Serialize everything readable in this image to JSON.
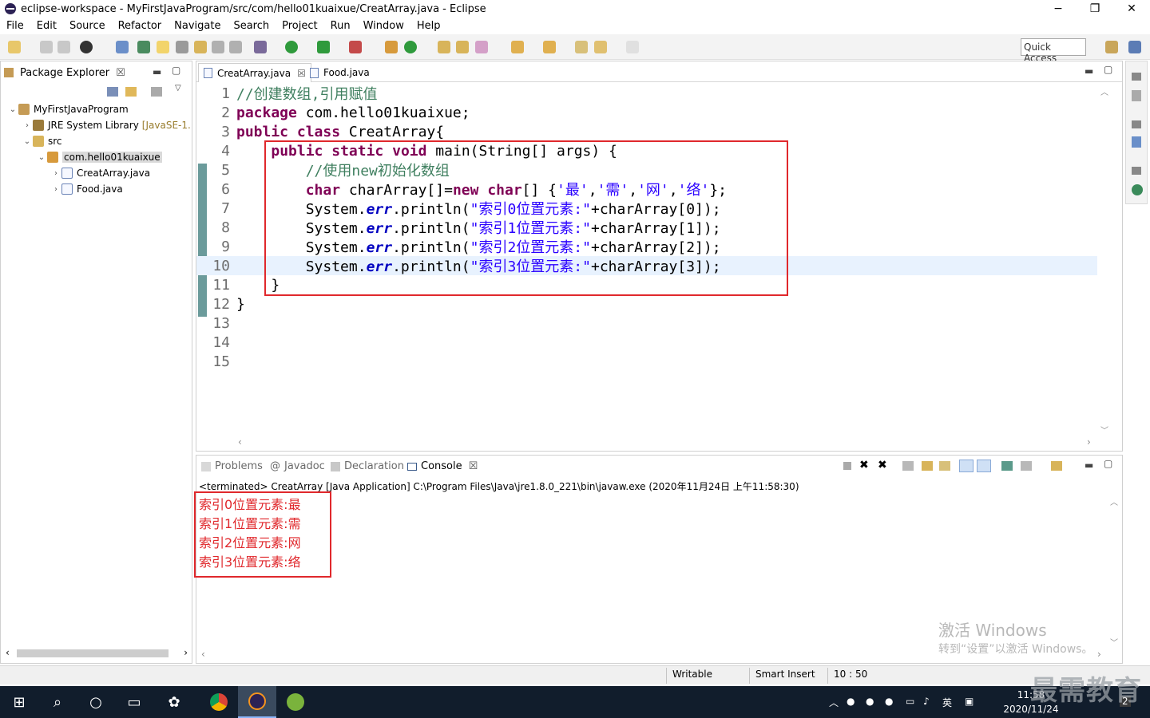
{
  "window": {
    "title": "eclipse-workspace - MyFirstJavaProgram/src/com/hello01kuaixue/CreatArray.java - Eclipse",
    "minimize": "−",
    "maximize": "❐",
    "close": "✕"
  },
  "menu": [
    "File",
    "Edit",
    "Source",
    "Refactor",
    "Navigate",
    "Search",
    "Project",
    "Run",
    "Window",
    "Help"
  ],
  "toolbar": {
    "quick_access": "Quick Access"
  },
  "package_explorer": {
    "tab_label": "Package Explorer",
    "tree": [
      {
        "label": "MyFirstJavaProgram",
        "decor": ""
      },
      {
        "label": "JRE System Library",
        "decor": "[JavaSE-1."
      },
      {
        "label": "src",
        "decor": ""
      },
      {
        "label": "com.hello01kuaixue",
        "decor": ""
      },
      {
        "label": "CreatArray.java",
        "decor": ""
      },
      {
        "label": "Food.java",
        "decor": ""
      }
    ]
  },
  "editor": {
    "tabs": [
      "CreatArray.java",
      "Food.java"
    ],
    "line_numbers": [
      "1",
      "2",
      "3",
      "4",
      "5",
      "6",
      "7",
      "8",
      "9",
      "10",
      "11",
      "12",
      "13",
      "14",
      "15"
    ],
    "lines": [
      [
        {
          "t": "//创建数组,引用赋值",
          "c": "cm"
        }
      ],
      [
        {
          "t": "package",
          "c": "kw"
        },
        {
          "t": " com.hello01kuaixue;",
          "c": ""
        }
      ],
      [
        {
          "t": "public",
          "c": "kw"
        },
        {
          "t": " ",
          "c": ""
        },
        {
          "t": "class",
          "c": "kw"
        },
        {
          "t": " CreatArray{",
          "c": ""
        }
      ],
      [
        {
          "t": "    ",
          "c": ""
        },
        {
          "t": "public",
          "c": "kw"
        },
        {
          "t": " ",
          "c": ""
        },
        {
          "t": "static",
          "c": "kw"
        },
        {
          "t": " ",
          "c": ""
        },
        {
          "t": "void",
          "c": "kw"
        },
        {
          "t": " main(String[] args) {",
          "c": ""
        }
      ],
      [
        {
          "t": "        //使用new初始化数组",
          "c": "cm"
        }
      ],
      [
        {
          "t": "        ",
          "c": ""
        },
        {
          "t": "char",
          "c": "kw"
        },
        {
          "t": " charArray[]=",
          "c": ""
        },
        {
          "t": "new",
          "c": "kw"
        },
        {
          "t": " ",
          "c": ""
        },
        {
          "t": "char",
          "c": "kw"
        },
        {
          "t": "[] {",
          "c": ""
        },
        {
          "t": "'最'",
          "c": "st"
        },
        {
          "t": ",",
          "c": ""
        },
        {
          "t": "'需'",
          "c": "st"
        },
        {
          "t": ",",
          "c": ""
        },
        {
          "t": "'网'",
          "c": "st"
        },
        {
          "t": ",",
          "c": ""
        },
        {
          "t": "'络'",
          "c": "st"
        },
        {
          "t": "};",
          "c": ""
        }
      ],
      [
        {
          "t": "        System.",
          "c": ""
        },
        {
          "t": "err",
          "c": "fd"
        },
        {
          "t": ".println(",
          "c": ""
        },
        {
          "t": "\"索引0位置元素:\"",
          "c": "st"
        },
        {
          "t": "+charArray[0]);",
          "c": ""
        }
      ],
      [
        {
          "t": "        System.",
          "c": ""
        },
        {
          "t": "err",
          "c": "fd"
        },
        {
          "t": ".println(",
          "c": ""
        },
        {
          "t": "\"索引1位置元素:\"",
          "c": "st"
        },
        {
          "t": "+charArray[1]);",
          "c": ""
        }
      ],
      [
        {
          "t": "        System.",
          "c": ""
        },
        {
          "t": "err",
          "c": "fd"
        },
        {
          "t": ".println(",
          "c": ""
        },
        {
          "t": "\"索引2位置元素:\"",
          "c": "st"
        },
        {
          "t": "+charArray[2]);",
          "c": ""
        }
      ],
      [
        {
          "t": "        System.",
          "c": ""
        },
        {
          "t": "err",
          "c": "fd"
        },
        {
          "t": ".println(",
          "c": ""
        },
        {
          "t": "\"索引3位置元素:\"",
          "c": "st"
        },
        {
          "t": "+charArray[3]);",
          "c": ""
        }
      ],
      [
        {
          "t": "    }",
          "c": ""
        }
      ],
      [
        {
          "t": "}",
          "c": ""
        }
      ],
      [],
      [],
      []
    ],
    "current_line": 10
  },
  "console": {
    "tabs": [
      "Problems",
      "Javadoc",
      "Declaration",
      "Console"
    ],
    "terminated": "<terminated> CreatArray [Java Application] C:\\Program Files\\Java\\jre1.8.0_221\\bin\\javaw.exe (2020年11月24日 上午11:58:30)",
    "output": [
      "索引0位置元素:最",
      "索引1位置元素:需",
      "索引2位置元素:网",
      "索引3位置元素:络"
    ]
  },
  "status": {
    "writable": "Writable",
    "insert": "Smart Insert",
    "position": "10 : 50"
  },
  "watermark": {
    "line1": "激活 Windows",
    "line2": "转到“设置”以激活 Windows。"
  },
  "taskbar": {
    "ime": "英",
    "time": "11:58",
    "date": "2020/11/24",
    "badge": "2"
  },
  "brand_text": "最需教育"
}
